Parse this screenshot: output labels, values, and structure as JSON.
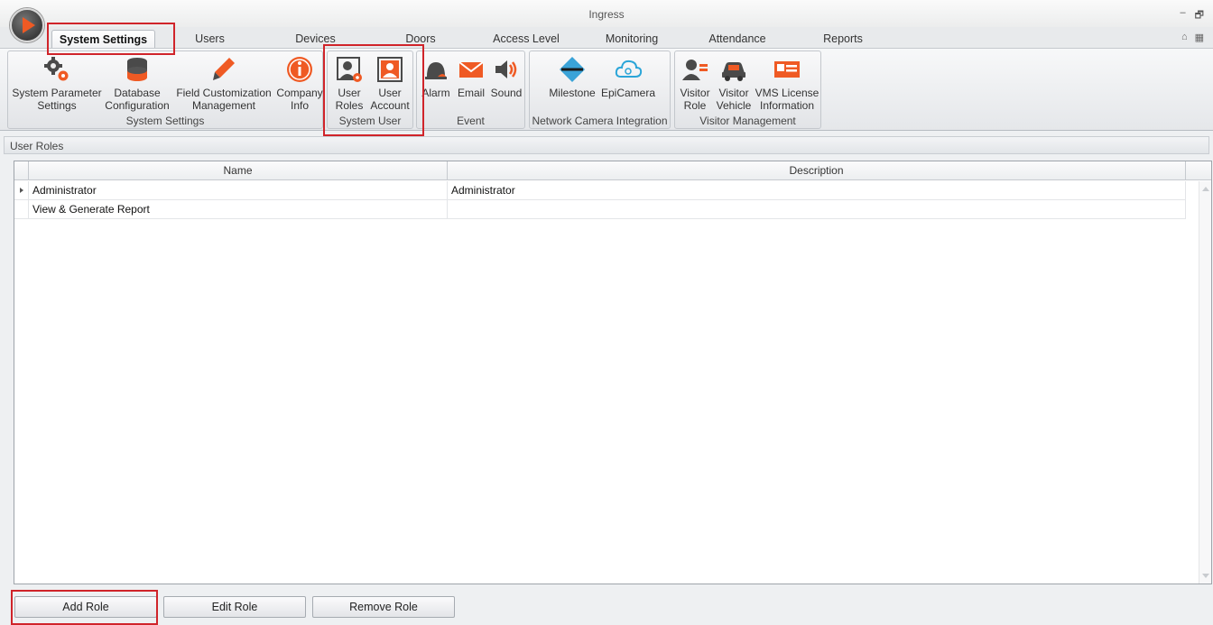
{
  "window": {
    "title": "Ingress",
    "minimize_glyph": "‒",
    "restore_glyph": "🗗"
  },
  "tabs": [
    "System Settings",
    "Users",
    "Devices",
    "Doors",
    "Access Level",
    "Monitoring",
    "Attendance",
    "Reports"
  ],
  "ribbon_right": {
    "collapse_glyph": "⌂",
    "layout_glyph": "▦"
  },
  "ribbon": {
    "groups": [
      {
        "label": "System Settings",
        "buttons": [
          {
            "label": "System Parameter\nSettings",
            "icon": "gears-icon"
          },
          {
            "label": "Database\nConfiguration",
            "icon": "database-icon"
          },
          {
            "label": "Field Customization\nManagement",
            "icon": "pencil-icon"
          },
          {
            "label": "Company\nInfo",
            "icon": "info-icon"
          }
        ]
      },
      {
        "label": "System User",
        "buttons": [
          {
            "label": "User\nRoles",
            "icon": "user-roles-icon"
          },
          {
            "label": "User\nAccount",
            "icon": "user-account-icon"
          }
        ]
      },
      {
        "label": "Event",
        "buttons": [
          {
            "label": "Alarm",
            "icon": "alarm-bell-icon"
          },
          {
            "label": "Email",
            "icon": "email-icon"
          },
          {
            "label": "Sound",
            "icon": "speaker-icon"
          }
        ]
      },
      {
        "label": "Network Camera Integration",
        "buttons": [
          {
            "label": "Milestone",
            "icon": "milestone-icon"
          },
          {
            "label": "EpiCamera",
            "icon": "cloud-camera-icon"
          }
        ]
      },
      {
        "label": "Visitor Management",
        "buttons": [
          {
            "label": "Visitor\nRole",
            "icon": "visitor-role-icon"
          },
          {
            "label": "Visitor\nVehicle",
            "icon": "car-icon"
          },
          {
            "label": "VMS License\nInformation",
            "icon": "license-card-icon"
          }
        ]
      }
    ]
  },
  "section": {
    "title": "User Roles"
  },
  "grid": {
    "columns": [
      "Name",
      "Description"
    ],
    "rows": [
      {
        "name": "Administrator",
        "description": "Administrator"
      },
      {
        "name": "View & Generate Report",
        "description": ""
      }
    ]
  },
  "actions": {
    "add": "Add Role",
    "edit": "Edit Role",
    "remove": "Remove Role"
  },
  "colors": {
    "accent": "#ef5a24",
    "highlight": "#d0242a",
    "milestone": "#3aa3d8",
    "epicamera": "#2aa5d8"
  }
}
